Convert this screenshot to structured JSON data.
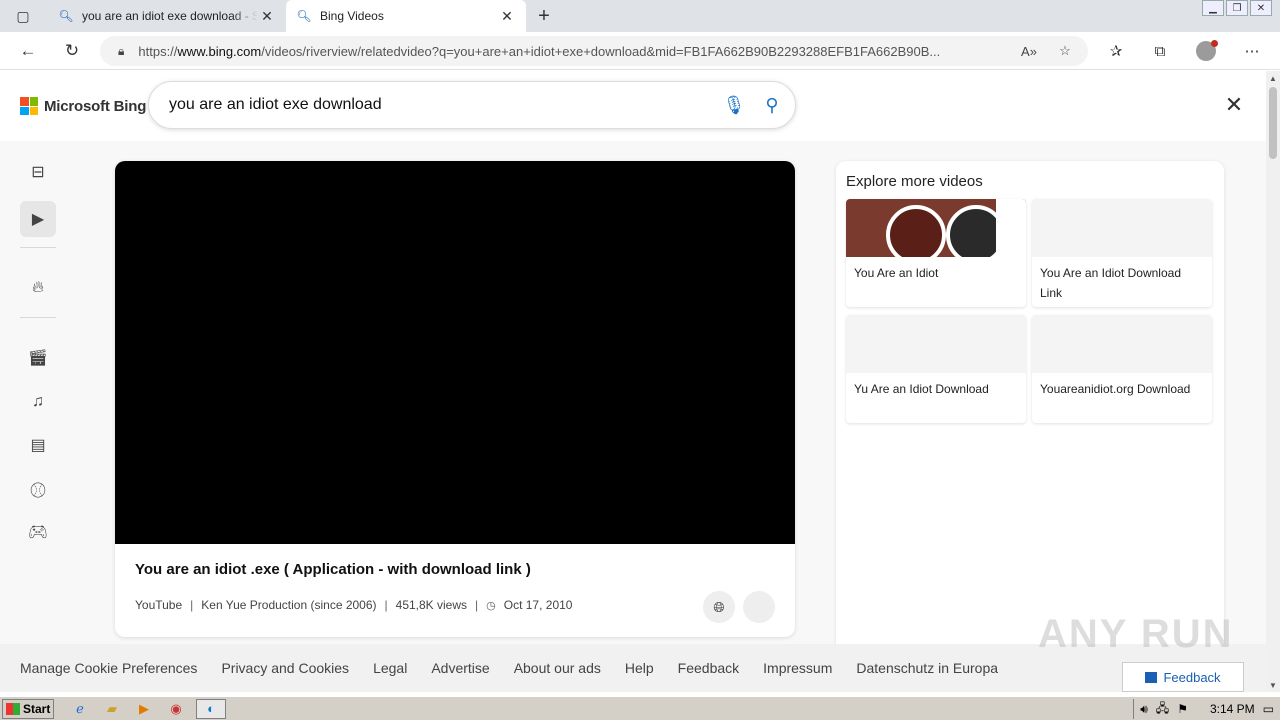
{
  "browser": {
    "tabs": [
      {
        "title": "you are an idiot exe download - Search",
        "active": false
      },
      {
        "title": "Bing Videos",
        "active": true
      }
    ],
    "url_prefix": "https://",
    "url_domain": "www.bing.com",
    "url_rest": "/videos/riverview/relatedvideo?q=you+are+an+idiot+exe+download&mid=FB1FA662B90B2293288EFB1FA662B90B..."
  },
  "bing": {
    "brand": "Microsoft Bing",
    "search_value": "you are an idiot exe download",
    "logo_colors": [
      "#f25022",
      "#7fba00",
      "#00a4ef",
      "#ffb900"
    ],
    "rail_icons": [
      "collapse-panel-icon",
      "video-icon",
      "trending-icon",
      "film-icon",
      "music-icon",
      "news-icon",
      "sports-icon",
      "gaming-icon"
    ]
  },
  "video": {
    "title": "You are an idiot .exe ( Application - with download link )",
    "source": "YouTube",
    "channel": "Ken Yue Production (since 2006)",
    "views": "451,8K views",
    "date": "Oct 17, 2010",
    "separator": "|"
  },
  "explore": {
    "title": "Explore more videos",
    "items": [
      {
        "label": "You Are an Idiot"
      },
      {
        "label": "You Are an Idiot Download Link"
      },
      {
        "label": "Yu Are an Idiot Download"
      },
      {
        "label": "Youareanidiot.org Download"
      }
    ]
  },
  "footer": {
    "links": [
      "Manage Cookie Preferences",
      "Privacy and Cookies",
      "Legal",
      "Advertise",
      "About our ads",
      "Help",
      "Feedback",
      "Impressum",
      "Datenschutz in Europa"
    ],
    "copyright_fragment": "©",
    "feedback_button": "Feedback"
  },
  "watermark": "ANY RUN",
  "taskbar": {
    "start_label": "Start",
    "clock": "3:14 PM"
  }
}
